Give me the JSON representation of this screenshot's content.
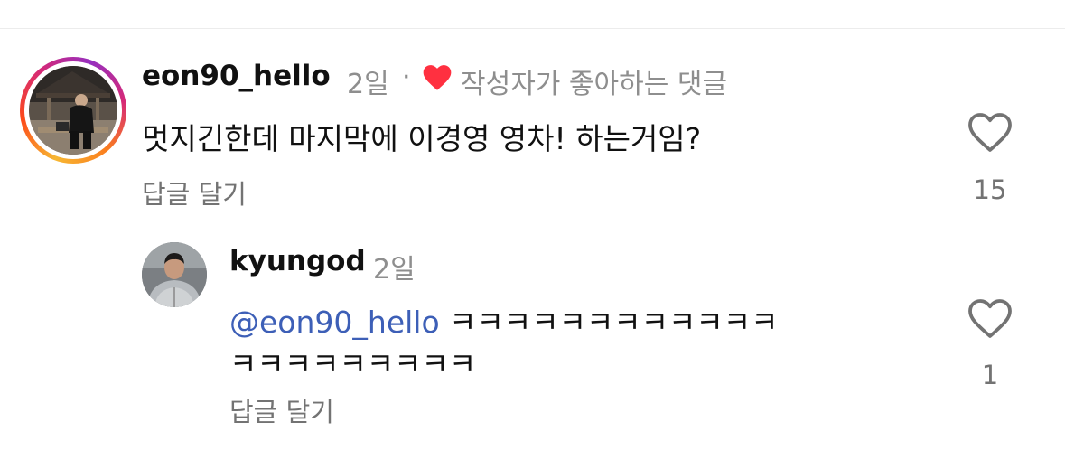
{
  "comments": [
    {
      "username": "eon90_hello",
      "age": "2일",
      "separator": "·",
      "creator_liked_label": "작성자가 좋아하는 댓글",
      "text": "멋지긴한데 마지막에 이경영 영차! 하는거임?",
      "reply_label": "답글 달기",
      "like_count": "15",
      "avatar_has_story_ring": true
    }
  ],
  "replies": [
    {
      "username": "kyungod",
      "age": "2일",
      "mention": "@eon90_hello",
      "text_line1": " ㅋㅋㅋㅋㅋㅋㅋㅋㅋㅋㅋㅋ",
      "text_line2": "ㅋㅋㅋㅋㅋㅋㅋㅋㅋ",
      "reply_label": "답글 달기",
      "like_count": "1"
    }
  ],
  "icons": {
    "like": "heart-outline-icon",
    "creator_like": "heart-filled-icon"
  },
  "colors": {
    "creator_heart": "#ff3040",
    "mention": "#3d5fb7",
    "secondary_text": "#8e8e8e"
  }
}
